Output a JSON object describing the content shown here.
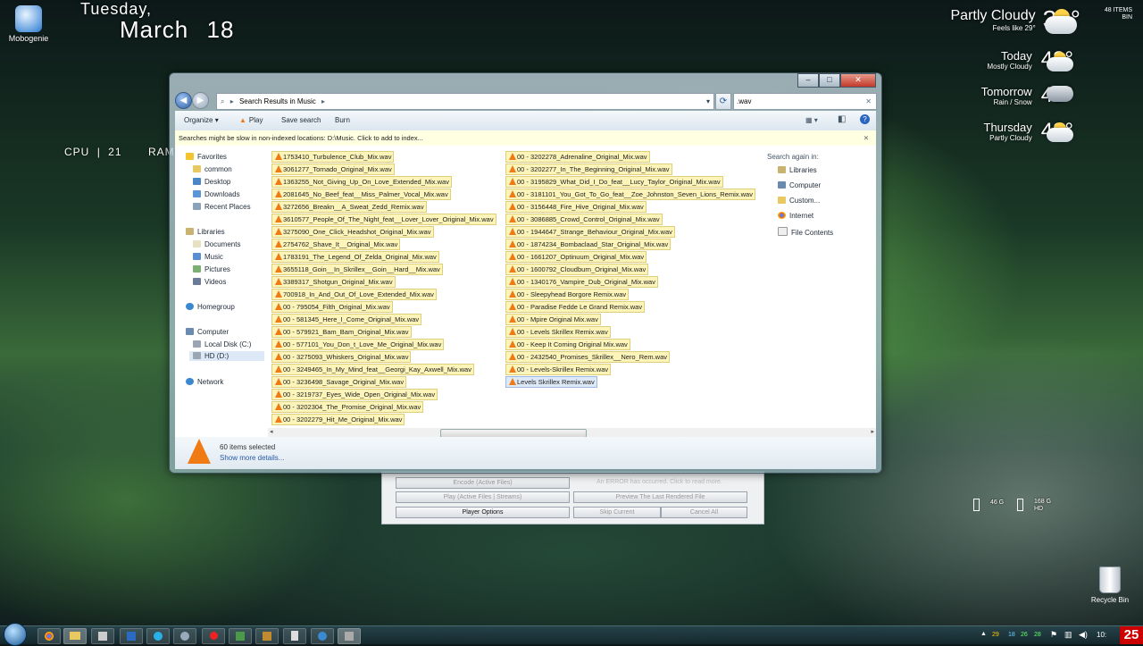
{
  "desktop": {
    "date_day": "Tuesday,",
    "date_month": "March",
    "date_num": "18",
    "cpu_label": "CPU",
    "cpu_sep": "|",
    "cpu_value": "21",
    "ram_label": "RAM",
    "icons": [
      {
        "label": "Mobogenie"
      },
      {
        "label": "Recycle Bin"
      }
    ],
    "items_bin": "48 ITEMS",
    "items_bin_sub": "BIN",
    "drives": [
      {
        "size": "46 G",
        "name": ""
      },
      {
        "size": "168 G",
        "name": "HD"
      }
    ]
  },
  "weather": {
    "current_condition": "Partly Cloudy",
    "current_temp": "36°",
    "feels_like": "Feels like 29°",
    "forecast": [
      {
        "day": "Today",
        "condition": "Mostly Cloudy",
        "temp": "43°"
      },
      {
        "day": "Tomorrow",
        "condition": "Rain / Snow",
        "temp": "40°"
      },
      {
        "day": "Thursday",
        "condition": "Partly Cloudy",
        "temp": "43°"
      }
    ]
  },
  "background_window": {
    "buttons": [
      "Encode (Active Files)",
      "Play (Active Files | Streams)",
      "Player Options",
      "Preview The Last Rendered File",
      "Skip Current",
      "Cancel All"
    ],
    "error_text": "An ERROR has occurred. Click to read more."
  },
  "explorer": {
    "breadcrumb": "Search Results in Music",
    "search_value": ".wav",
    "toolbar": {
      "organize": "Organize",
      "play": "Play",
      "save_search": "Save search",
      "burn": "Burn"
    },
    "infobar": "Searches might be slow in non-indexed locations: D:\\Music. Click to add to index...",
    "nav": {
      "favorites": "Favorites",
      "favorites_items": [
        "common",
        "Desktop",
        "Downloads",
        "Recent Places"
      ],
      "libraries": "Libraries",
      "libraries_items": [
        "Documents",
        "Music",
        "Pictures",
        "Videos"
      ],
      "homegroup": "Homegroup",
      "computer": "Computer",
      "computer_items": [
        "Local Disk (C:)",
        "HD (D:)"
      ],
      "network": "Network"
    },
    "files_col1": [
      "1753410_Turbulence_Club_Mix.wav",
      "3061277_Tornado_Original_Mix.wav",
      "1363255_Not_Giving_Up_On_Love_Extended_Mix.wav",
      "2081645_No_Beef_feat__Miss_Palmer_Vocal_Mix.wav",
      "3272656_Breakn__A_Sweat_Zedd_Remix.wav",
      "3610577_People_Of_The_Night_feat__Lover_Lover_Original_Mix.wav",
      "3275090_One_Click_Headshot_Original_Mix.wav",
      "2754762_Shave_It__Original_Mix.wav",
      "1783191_The_Legend_Of_Zelda_Original_Mix.wav",
      "3655118_Goin__In_Skrillex__Goin__Hard__Mix.wav",
      "3389317_Shotgun_Original_Mix.wav",
      "700918_In_And_Out_Of_Love_Extended_Mix.wav",
      "00 - 795054_Filth_Original_Mix.wav",
      "00 - 581345_Here_I_Come_Original_Mix.wav",
      "00 - 579921_Bam_Bam_Original_Mix.wav",
      "00 - 577101_You_Don_t_Love_Me_Original_Mix.wav",
      "00 - 3275093_Whiskers_Original_Mix.wav",
      "00 - 3249465_In_My_Mind_feat__Georgi_Kay_Axwell_Mix.wav",
      "00 - 3236498_Savage_Original_Mix.wav",
      "00 - 3219737_Eyes_Wide_Open_Original_Mix.wav",
      "00 - 3202304_The_Promise_Original_Mix.wav",
      "00 - 3202279_Hit_Me_Original_Mix.wav"
    ],
    "files_col2": [
      "00 - 3202278_Adrenaline_Original_Mix.wav",
      "00 - 3202277_In_The_Beginning_Original_Mix.wav",
      "00 - 3195829_What_Did_I_Do_feat__Lucy_Taylor_Original_Mix.wav",
      "00 - 3181101_You_Got_To_Go_feat__Zoe_Johnston_Seven_Lions_Remix.wav",
      "00 - 3156448_Fire_Hive_Original_Mix.wav",
      "00 - 3086885_Crowd_Control_Original_Mix.wav",
      "00 - 1944647_Strange_Behaviour_Original_Mix.wav",
      "00 - 1874234_Bombaclaad_Star_Original_Mix.wav",
      "00 - 1661207_Optinuum_Original_Mix.wav",
      "00 - 1600792_Cloudburn_Original_Mix.wav",
      "00 - 1340176_Vampire_Dub_Original_Mix.wav",
      "00 - Sleepyhead Borgore Remix.wav",
      "00 - Paradise Fedde Le Grand Remix.wav",
      "00 - Mpire Original Mix.wav",
      "00 - Levels Skrillex Remix.wav",
      "00 - Keep It Coming Original Mix.wav",
      "00 - 2432540_Promises_Skrillex__Nero_Rem.wav",
      "00 - Levels-Skrillex Remix.wav",
      "Levels Skrillex Remix.wav"
    ],
    "search_again": {
      "title": "Search again in:",
      "items": [
        "Libraries",
        "Computer",
        "Custom...",
        "Internet",
        "File Contents"
      ]
    },
    "details": {
      "selected": "60 items selected",
      "more": "Show more details..."
    }
  },
  "taskbar": {
    "tray_numbers": [
      "29",
      "18",
      "26",
      "28"
    ],
    "clock": "10:",
    "clock_big": "25"
  }
}
